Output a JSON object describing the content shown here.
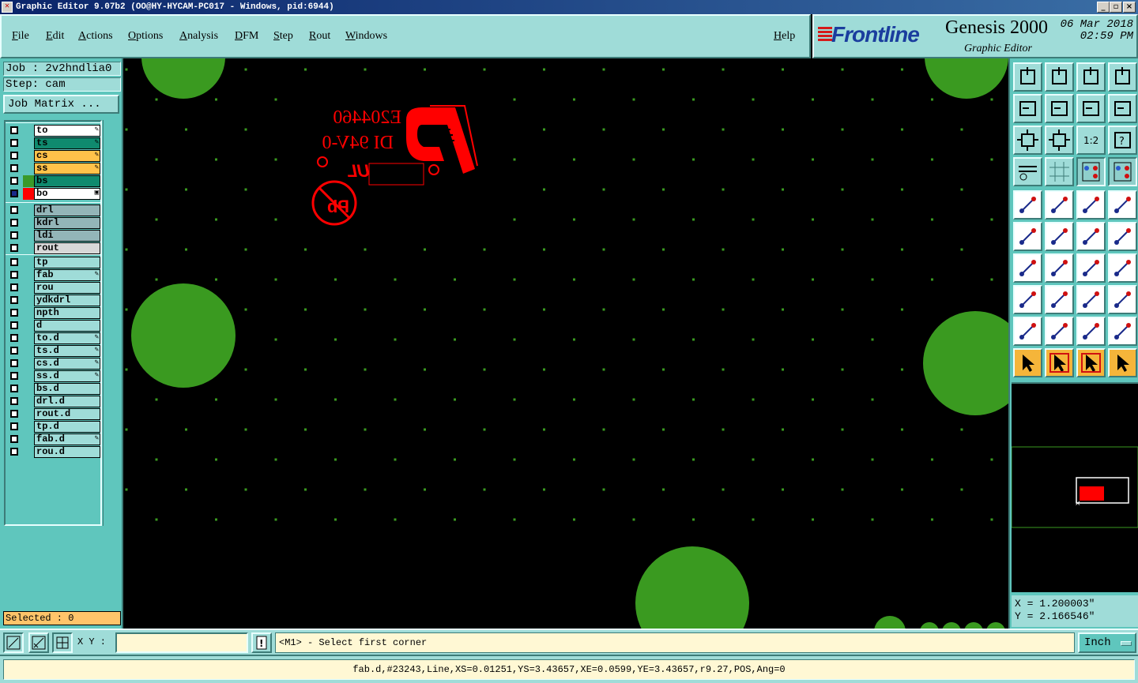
{
  "window": {
    "title": "Graphic Editor 9.07b2 (OO@HY-HYCAM-PC017 - Windows, pid:6944)"
  },
  "menu": {
    "items": [
      "File",
      "Edit",
      "Actions",
      "Options",
      "Analysis",
      "DFM",
      "Step",
      "Rout",
      "Windows"
    ],
    "help": "Help"
  },
  "brand": {
    "logo": "Frontline",
    "product": "Genesis 2000",
    "subtitle": "Graphic Editor",
    "date": "06 Mar 2018",
    "time": "02:59 PM"
  },
  "job": {
    "job_label": "Job : 2v2hndlia0",
    "step_label": "Step: cam",
    "matrix_button": "Job Matrix ..."
  },
  "layers": {
    "group1": [
      {
        "name": "to",
        "color": "#ffffff",
        "swatch": "",
        "mark": "✎"
      },
      {
        "name": "ts",
        "color": "#0f8a6e",
        "swatch": "",
        "mark": "✎"
      },
      {
        "name": "cs",
        "color": "#ffc24a",
        "swatch": "",
        "mark": "✎"
      },
      {
        "name": "ss",
        "color": "#ffc24a",
        "swatch": "",
        "mark": "✎"
      },
      {
        "name": "bs",
        "color": "#0f8a6e",
        "swatch": "#3a9a2a",
        "mark": ""
      },
      {
        "name": "bo",
        "color": "#ffffff",
        "swatch": "#ff0000",
        "mark": "▣"
      }
    ],
    "group2": [
      {
        "name": "drl",
        "color": "#93b5b8",
        "mark": ""
      },
      {
        "name": "kdrl",
        "color": "#93b5b8",
        "mark": ""
      },
      {
        "name": "ldi",
        "color": "#93b5b8",
        "mark": ""
      },
      {
        "name": "rout",
        "color": "#d8d8d8",
        "mark": ""
      }
    ],
    "group3": [
      {
        "name": "tp",
        "color": "#9fdcd8",
        "mark": ""
      },
      {
        "name": "fab",
        "color": "#9fdcd8",
        "mark": "✎"
      },
      {
        "name": "rou",
        "color": "#9fdcd8",
        "mark": ""
      },
      {
        "name": "ydkdrl",
        "color": "#9fdcd8",
        "mark": ""
      },
      {
        "name": "npth",
        "color": "#9fdcd8",
        "mark": ""
      },
      {
        "name": "d",
        "color": "#9fdcd8",
        "mark": ""
      },
      {
        "name": "to.d",
        "color": "#9fdcd8",
        "mark": "✎"
      },
      {
        "name": "ts.d",
        "color": "#9fdcd8",
        "mark": "✎"
      },
      {
        "name": "cs.d",
        "color": "#9fdcd8",
        "mark": "✎"
      },
      {
        "name": "ss.d",
        "color": "#9fdcd8",
        "mark": "✎"
      },
      {
        "name": "bs.d",
        "color": "#9fdcd8",
        "mark": ""
      },
      {
        "name": "drl.d",
        "color": "#9fdcd8",
        "mark": ""
      },
      {
        "name": "rout.d",
        "color": "#9fdcd8",
        "mark": ""
      },
      {
        "name": "tp.d",
        "color": "#9fdcd8",
        "mark": ""
      },
      {
        "name": "fab.d",
        "color": "#9fdcd8",
        "mark": "✎"
      },
      {
        "name": "rou.d",
        "color": "#9fdcd8",
        "mark": ""
      }
    ]
  },
  "selected": "Selected : 0",
  "canvas": {
    "silkscreen": {
      "line1": "E204460",
      "line2": "DI 94V-0",
      "ul_mark": "UL",
      "pb_mark": "Pb"
    }
  },
  "coords": {
    "x": "X =  1.200003\"",
    "y": "Y =  2.166546\""
  },
  "command": {
    "xy_label": "X Y :",
    "xy_value": "",
    "prompt": "<M1> - Select first corner",
    "units": "Inch"
  },
  "status": {
    "text": "fab.d,#23243,Line,XS=0.01251,YS=3.43657,XE=0.0599,YE=3.43657,r9.27,POS,Ang=0"
  },
  "colors": {
    "panel": "#9fdcd8",
    "panel_dark": "#5fc6bd",
    "pad_green": "#3a9a20",
    "silk_red": "#ff0000"
  }
}
